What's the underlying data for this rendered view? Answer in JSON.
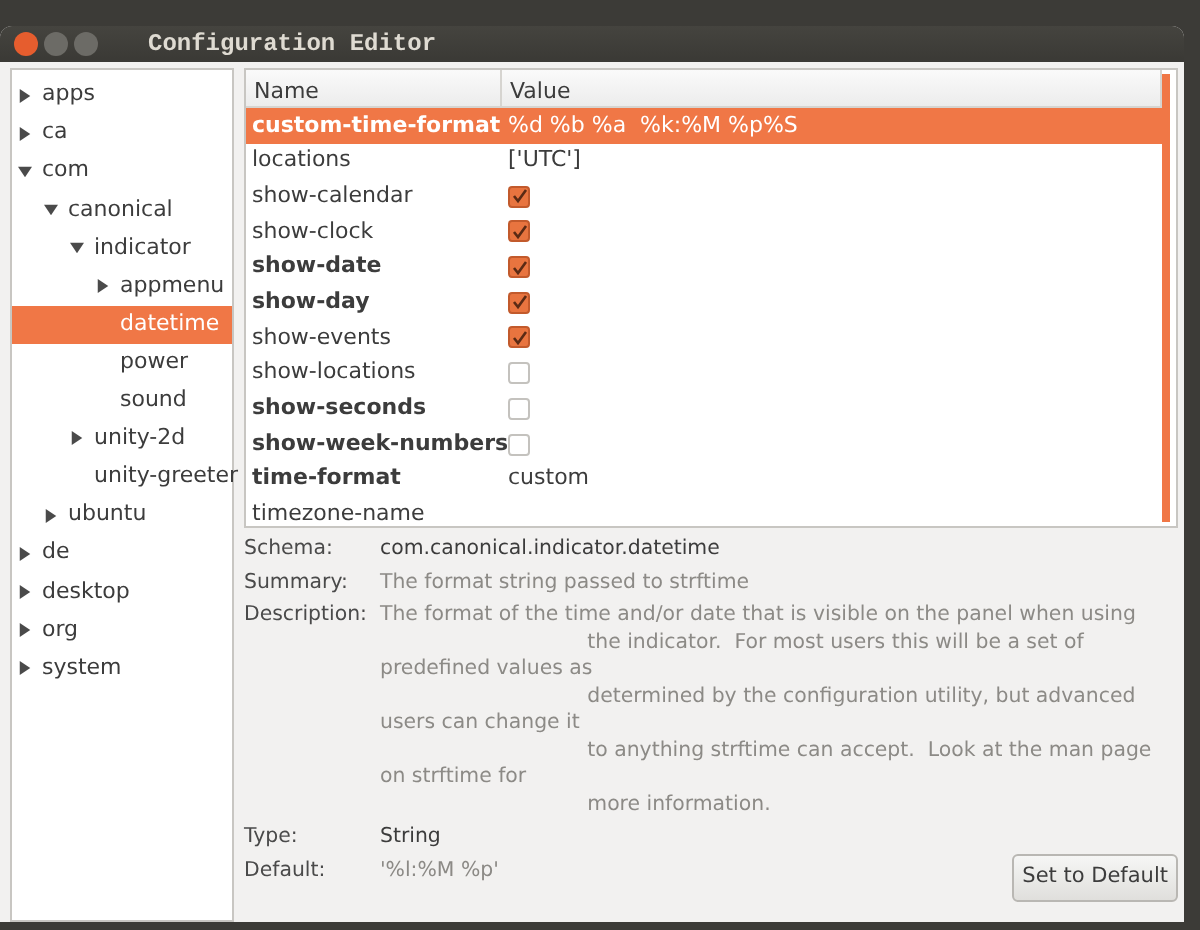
{
  "window": {
    "title": "Configuration Editor"
  },
  "tree": [
    {
      "label": "apps",
      "expanded": false,
      "selected": false
    },
    {
      "label": "ca",
      "expanded": false,
      "selected": false
    },
    {
      "label": "com",
      "expanded": true,
      "selected": false,
      "children": [
        {
          "label": "canonical",
          "expanded": true,
          "selected": false,
          "children": [
            {
              "label": "indicator",
              "expanded": true,
              "selected": false,
              "children": [
                {
                  "label": "appmenu",
                  "expanded": false,
                  "selected": false
                },
                {
                  "label": "datetime",
                  "selected": true
                },
                {
                  "label": "power",
                  "selected": false
                },
                {
                  "label": "sound",
                  "selected": false
                }
              ]
            },
            {
              "label": "unity-2d",
              "expanded": false,
              "selected": false
            },
            {
              "label": "unity-greeter",
              "selected": false
            }
          ]
        },
        {
          "label": "ubuntu",
          "expanded": false,
          "selected": false
        }
      ]
    },
    {
      "label": "de",
      "expanded": false,
      "selected": false
    },
    {
      "label": "desktop",
      "expanded": false,
      "selected": false
    },
    {
      "label": "org",
      "expanded": false,
      "selected": false
    },
    {
      "label": "system",
      "expanded": false,
      "selected": false
    }
  ],
  "table": {
    "columns": [
      "Name",
      "Value"
    ],
    "rows": [
      {
        "name": "custom-time-format",
        "modified": true,
        "selected": true,
        "kind": "text",
        "value": "%d %b %a  %k:%M %p%S"
      },
      {
        "name": "locations",
        "modified": false,
        "selected": false,
        "kind": "text",
        "value": "['UTC']"
      },
      {
        "name": "show-calendar",
        "modified": false,
        "selected": false,
        "kind": "check",
        "checked": true
      },
      {
        "name": "show-clock",
        "modified": false,
        "selected": false,
        "kind": "check",
        "checked": true
      },
      {
        "name": "show-date",
        "modified": true,
        "selected": false,
        "kind": "check",
        "checked": true
      },
      {
        "name": "show-day",
        "modified": true,
        "selected": false,
        "kind": "check",
        "checked": true
      },
      {
        "name": "show-events",
        "modified": false,
        "selected": false,
        "kind": "check",
        "checked": true
      },
      {
        "name": "show-locations",
        "modified": false,
        "selected": false,
        "kind": "check",
        "checked": false
      },
      {
        "name": "show-seconds",
        "modified": true,
        "selected": false,
        "kind": "check",
        "checked": false
      },
      {
        "name": "show-week-numbers",
        "modified": true,
        "selected": false,
        "kind": "check",
        "checked": false
      },
      {
        "name": "time-format",
        "modified": true,
        "selected": false,
        "kind": "text",
        "value": "custom"
      },
      {
        "name": "timezone-name",
        "modified": false,
        "selected": false,
        "kind": "text"
      }
    ]
  },
  "details": [
    {
      "label": "Schema:",
      "value": "com.canonical.indicator.datetime",
      "dim": false
    },
    {
      "label": "Summary:",
      "value": "The format string passed to strftime",
      "dim": true
    },
    {
      "label": "Description:",
      "value": "The format of the time and/or date that is visible on the panel when using\n                                the indicator.  For most users this will be a set of predefined values as\n                                determined by the configuration utility, but advanced users can change it\n                                to anything strftime can accept.  Look at the man page on strftime for\n                                more information.",
      "dim": true
    },
    {
      "label": "Type:",
      "value": "String",
      "dim": false
    },
    {
      "label": "Default:",
      "value": "'%l:%M %p'",
      "dim": true
    }
  ],
  "buttons": [
    "Set to Default"
  ]
}
